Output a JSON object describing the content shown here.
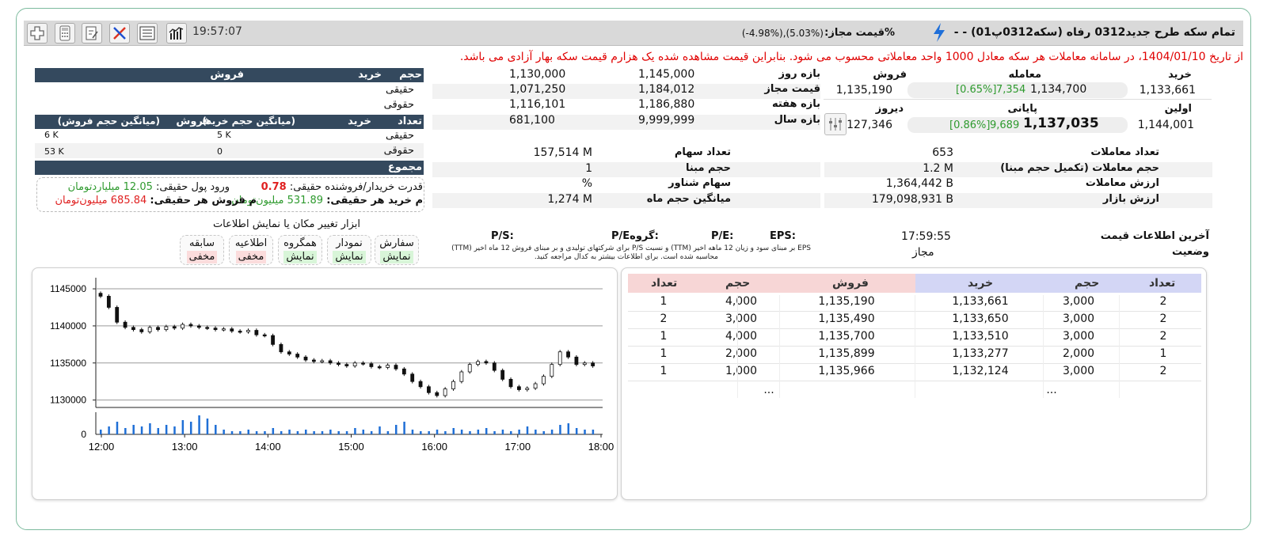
{
  "header": {
    "title": "تمام سکه طرح جدید0312 رفاه (سکه0312پ01) - -",
    "price_label": "%قیمت مجاز:",
    "price_value": "(-4.98%),(5.03%)",
    "time": "19:57:07",
    "toolbar_icons": [
      "chart-bars-icon",
      "list-icon",
      "tools-icon",
      "edit-note-icon",
      "calculator-icon",
      "add-icon"
    ]
  },
  "notice": "از تاریخ 1404/01/10، در سامانه معاملات هر سکه معادل 1000 واحد معاملاتی محسوب می شود. بنابراین قیمت مشاهده شده یک هزارم قیمت سکه بهار آزادی می باشد.",
  "price_block": {
    "buy_label": "خرید",
    "trade_label": "معامله",
    "sell_label": "فروش",
    "buy": "1,133,661",
    "trade_price": "1,134,700",
    "trade_change": "7,354",
    "trade_pct": "[0.65%]",
    "sell": "1,135,190",
    "first_label": "اولین",
    "close_label": "پایانی",
    "yesterday_label": "دیروز",
    "first": "1,144,001",
    "close_price": "1,137,035",
    "close_change": "9,689",
    "close_pct": "[0.86%]",
    "yesterday": "1,127,346"
  },
  "ranges": [
    {
      "label": "بازه روز",
      "max": "1,145,000",
      "min": "1,130,000"
    },
    {
      "label": "قیمت مجاز",
      "max": "1,184,012",
      "min": "1,071,250"
    },
    {
      "label": "بازه هفته",
      "max": "1,186,880",
      "min": "1,116,101"
    },
    {
      "label": "بازه سال",
      "max": "9,999,999",
      "min": "681,100"
    }
  ],
  "client_table": {
    "header": {
      "volume": "حجم",
      "buy": "خرید",
      "sell": "فروش"
    },
    "rows": [
      {
        "label": "حقیقی"
      },
      {
        "label": "حقوقی"
      }
    ],
    "header2": {
      "count": "تعداد",
      "buy": "خرید",
      "avg_buy": "(میانگین حجم خرید)",
      "sell": "فروش",
      "avg_sell": "(میانگین حجم فروش)"
    },
    "rows2": [
      {
        "label": "حقیقی",
        "avg_buy": "5 K",
        "avg_sell": "6 K"
      },
      {
        "label": "حقوقی",
        "avg_buy": "0",
        "avg_sell": "53 K"
      }
    ],
    "total_label": "مجموع"
  },
  "power": {
    "ratio_label": "قدرت خریدار/فروشنده حقیقی:",
    "ratio_value": "0.78",
    "inflow_label": "ورود پول حقیقی:",
    "inflow_value": "12.05 میلیاردتومان",
    "avg_buy_label": "م خرید هر حقیقی:",
    "avg_buy_value": "531.89 میلیون‌تومان",
    "avg_sell_label": "م فروش هر حقیقی:",
    "avg_sell_value": "685.84 میلیون‌تومان"
  },
  "tools": {
    "title": "ابزار تغییر مکان یا نمایش اطلاعات",
    "items": [
      {
        "label": "سفارش",
        "state": "نمایش"
      },
      {
        "label": "نمودار",
        "state": "نمایش"
      },
      {
        "label": "همگروه",
        "state": "نمایش"
      },
      {
        "label": "اطلاعیه",
        "state": "مخفی"
      },
      {
        "label": "سابقه",
        "state": "مخفی"
      }
    ]
  },
  "stats_left": [
    {
      "label": "تعداد سهام",
      "value": "157,514 M"
    },
    {
      "label": "حجم مبنا",
      "value": "1"
    },
    {
      "label": "سهام شناور",
      "value": "%"
    },
    {
      "label": "میانگین حجم ماه",
      "value": "1,274 M"
    }
  ],
  "stats_right": [
    {
      "label": "تعداد معاملات",
      "value": "653"
    },
    {
      "label": "حجم معاملات (تکمیل حجم مبنا)",
      "value": "1.2 M"
    },
    {
      "label": "ارزش معاملات",
      "value": "1,364,442 B"
    },
    {
      "label": "ارزش بازار",
      "value": "179,098,931 B"
    }
  ],
  "ratios": {
    "eps": "EPS:",
    "pe": "P/E:",
    "group_pe": "P/Eگروه:",
    "ps": "P/S:",
    "note1": "EPS بر مبنای سود و زیان 12 ماهه اخیر (TTM) و نسبت P/S برای شرکتهای تولیدی و بر مبنای فروش 12 ماه اخیر (TTM)",
    "note2": "محاسبه شده است. برای اطلاعات بیشتر به کدال مراجعه کنید."
  },
  "last_info": {
    "label": "آخرین اطلاعات قیمت",
    "time": "17:59:55",
    "status_label": "وضعیت",
    "status": "مجاز"
  },
  "order_book": {
    "headers": {
      "count": "تعداد",
      "volume": "حجم",
      "buy": "خرید",
      "sell": "فروش"
    },
    "rows": [
      {
        "buy_count": "2",
        "buy_vol": "3,000",
        "buy_price": "1,133,661",
        "sell_price": "1,135,190",
        "sell_vol": "4,000",
        "sell_count": "1"
      },
      {
        "buy_count": "2",
        "buy_vol": "3,000",
        "buy_price": "1,133,650",
        "sell_price": "1,135,490",
        "sell_vol": "3,000",
        "sell_count": "2"
      },
      {
        "buy_count": "2",
        "buy_vol": "3,000",
        "buy_price": "1,133,510",
        "sell_price": "1,135,700",
        "sell_vol": "4,000",
        "sell_count": "1"
      },
      {
        "buy_count": "1",
        "buy_vol": "2,000",
        "buy_price": "1,133,277",
        "sell_price": "1,135,899",
        "sell_vol": "2,000",
        "sell_count": "1"
      },
      {
        "buy_count": "2",
        "buy_vol": "3,000",
        "buy_price": "1,132,124",
        "sell_price": "1,135,966",
        "sell_vol": "1,000",
        "sell_count": "1"
      }
    ],
    "more": "..."
  },
  "chart_data": {
    "type": "candlestick",
    "x_ticks": [
      "12:00",
      "13:00",
      "14:00",
      "15:00",
      "16:00",
      "17:00",
      "18:00"
    ],
    "y_ticks": [
      1145000,
      1140000,
      1135000,
      1130000
    ],
    "ylim": [
      1129000,
      1146500
    ],
    "volume_ticks": [
      0
    ],
    "prices": [
      1144000,
      1142500,
      1140500,
      1139800,
      1139500,
      1139200,
      1139800,
      1139500,
      1139900,
      1139700,
      1140200,
      1140000,
      1139800,
      1139700,
      1139500,
      1139600,
      1139300,
      1139200,
      1139400,
      1138800,
      1138700,
      1137500,
      1136500,
      1136200,
      1135800,
      1135400,
      1135200,
      1135300,
      1135000,
      1134800,
      1134600,
      1135000,
      1134900,
      1134500,
      1134400,
      1134700,
      1134200,
      1133500,
      1132500,
      1131800,
      1131000,
      1130600,
      1131500,
      1132500,
      1133800,
      1134800,
      1135200,
      1135000,
      1134000,
      1132800,
      1131800,
      1131400,
      1131600,
      1132200,
      1133200,
      1134800,
      1136500,
      1135800,
      1134800,
      1135000,
      1134600
    ],
    "volumes": [
      3,
      5,
      8,
      4,
      6,
      5,
      7,
      4,
      6,
      5,
      9,
      8,
      12,
      10,
      6,
      3,
      2,
      2,
      3,
      2,
      2,
      4,
      2,
      3,
      2,
      3,
      2,
      2,
      3,
      2,
      2,
      4,
      3,
      2,
      5,
      2,
      6,
      8,
      3,
      2,
      2,
      3,
      2,
      4,
      3,
      2,
      3,
      4,
      2,
      3,
      2,
      3,
      5,
      3,
      2,
      3,
      6,
      7,
      4,
      3,
      3
    ]
  }
}
